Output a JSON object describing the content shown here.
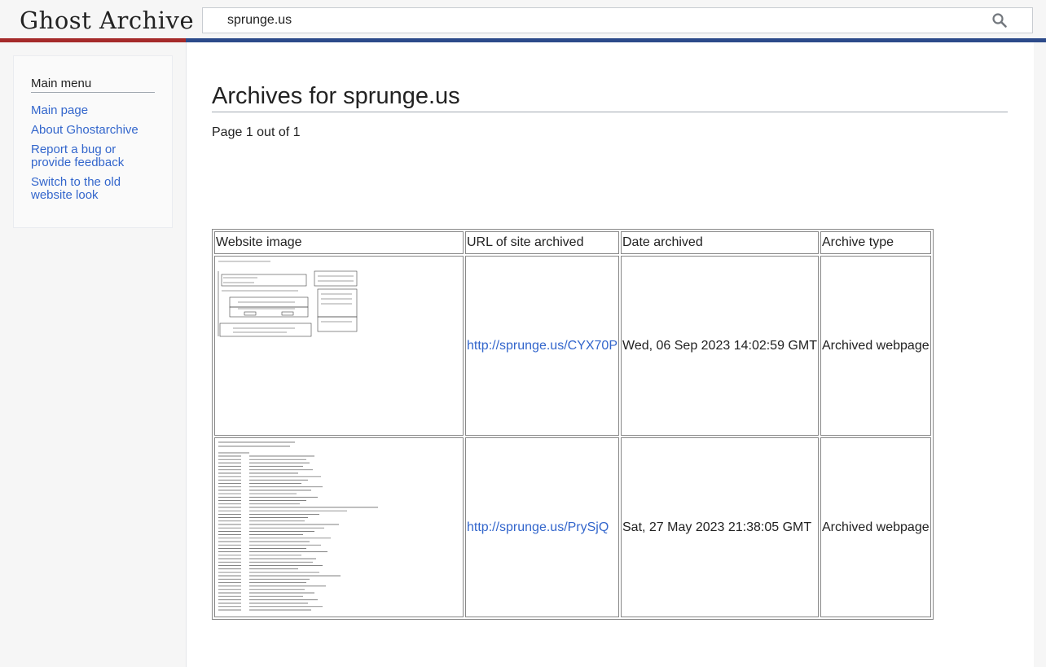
{
  "header": {
    "logo_text": "Ghost Archive",
    "search": {
      "value": "sprunge.us",
      "placeholder": ""
    },
    "search_button_icon": "magnifier-icon"
  },
  "sidebar": {
    "heading": "Main menu",
    "items": [
      {
        "label": "Main page"
      },
      {
        "label": "About Ghostarchive"
      },
      {
        "label": "Report a bug or provide feedback"
      },
      {
        "label": "Switch to the old website look"
      }
    ]
  },
  "main": {
    "title": "Archives for sprunge.us",
    "page_info": "Page 1 out of 1",
    "table": {
      "headers": [
        "Website image",
        "URL of site archived",
        "Date archived",
        "Archive type"
      ],
      "rows": [
        {
          "image": "website-screenshot-thumbnail",
          "url": "http://sprunge.us/CYX70P",
          "date": "Wed, 06 Sep 2023 14:02:59 GMT",
          "type": "Archived webpage"
        },
        {
          "image": "website-screenshot-thumbnail",
          "url": "http://sprunge.us/PrySjQ",
          "date": "Sat, 27 May 2023 21:38:05 GMT",
          "type": "Archived webpage"
        }
      ]
    }
  },
  "colors": {
    "link": "#3366cc",
    "stripe_red": "#a52a2a",
    "stripe_blue": "#2c4a8a",
    "page_bg": "#f6f6f6"
  }
}
